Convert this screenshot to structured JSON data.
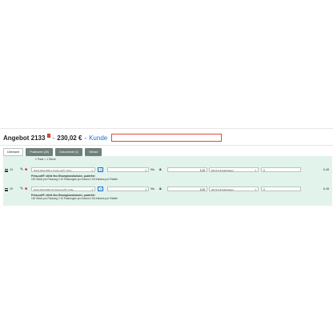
{
  "header": {
    "title": "Angebot 2133",
    "badge": "!",
    "separator1": " - ",
    "price": "230,02 €",
    "separator2": " - ",
    "kunde": "Kunde"
  },
  "tabs": [
    {
      "label": "Übersicht"
    },
    {
      "label": "Positionen (30)"
    },
    {
      "label": "Dokumente (1)"
    },
    {
      "label": "Verlauf"
    }
  ],
  "pack_note": "1 Pack = 1 Stück",
  "rows": [
    {
      "pos": "24",
      "article": "DHM-94211560-L Peha-soft® nitrile ...",
      "qty": "1",
      "unit": "Stk.",
      "price": "6,48",
      "tax": "[19 %] Umsatzsteuer",
      "discount": "0",
      "total": "6,48",
      "desc_title": "Peha-soft® nitrile fino Einweghandschuhe, puderfrei",
      "desc_line1": "100 Stück pro Packung // 10 Packungen pro Karton // 64 Kartons pro Palette"
    },
    {
      "pos": "25",
      "article": "DHM-94211560-XS Peha-soft® nitrile ...",
      "qty": "1",
      "unit": "Stk.",
      "price": "6,48",
      "tax": "[19 %] Umsatzsteuer",
      "discount": "0",
      "total": "6,48",
      "desc_title": "Peha-soft® nitrile fino Einweghandschuhe, puderfrei",
      "desc_line1": "100 Stück pro Packung // 10 Packungen pro Karton // 64 Kartons pro Palette"
    }
  ],
  "colors": {
    "accent_blue": "#1e6fd0",
    "panel_bg": "#e2f3ec",
    "tab_inactive": "#6f7f7a",
    "danger": "#c0392b"
  }
}
